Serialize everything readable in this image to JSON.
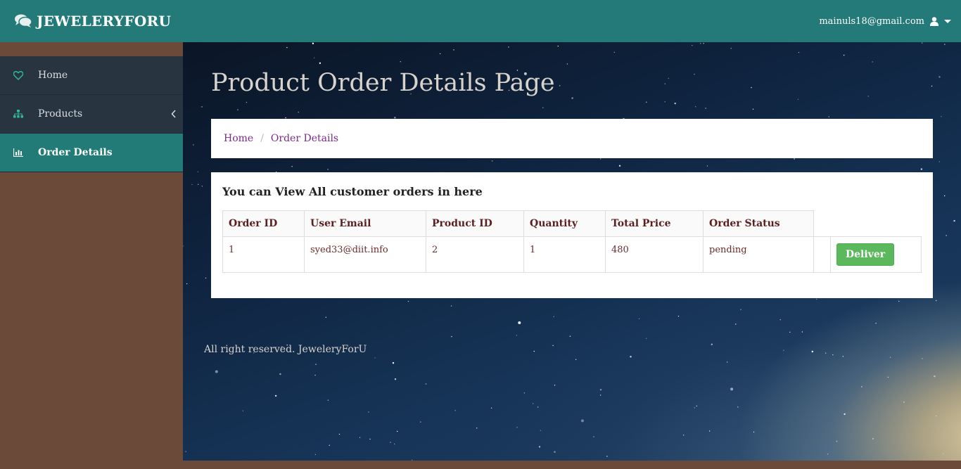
{
  "brand": {
    "name": "JEWELERYFORU",
    "icon": "comments-icon"
  },
  "user": {
    "email": "mainuls18@gmail.com",
    "icon": "user-icon"
  },
  "sidebar": {
    "items": [
      {
        "label": "Home",
        "icon": "heart-icon"
      },
      {
        "label": "Products",
        "icon": "sitemap-icon"
      },
      {
        "label": "Order Details",
        "icon": "bar-chart-icon"
      }
    ]
  },
  "page": {
    "title": "Product Order Details Page"
  },
  "breadcrumb": {
    "home": "Home",
    "current": "Order Details",
    "separator": "/"
  },
  "panel": {
    "heading": "You can View All customer orders in here",
    "columns": [
      "Order ID",
      "User Email",
      "Product ID",
      "Quantity",
      "Total Price",
      "Order Status"
    ],
    "rows": [
      {
        "order_id": "1",
        "email": "syed33@diit.info",
        "product_id": "2",
        "quantity": "1",
        "total": "480",
        "status": "pending",
        "action": "Deliver"
      }
    ]
  },
  "footer": {
    "text": "All right reserved. JeweleryForU"
  },
  "colors": {
    "topbar": "#247a78",
    "sidebar": "#283541",
    "active": "#227b76",
    "deliver": "#5cb85c",
    "body": "#6b4a3a"
  }
}
